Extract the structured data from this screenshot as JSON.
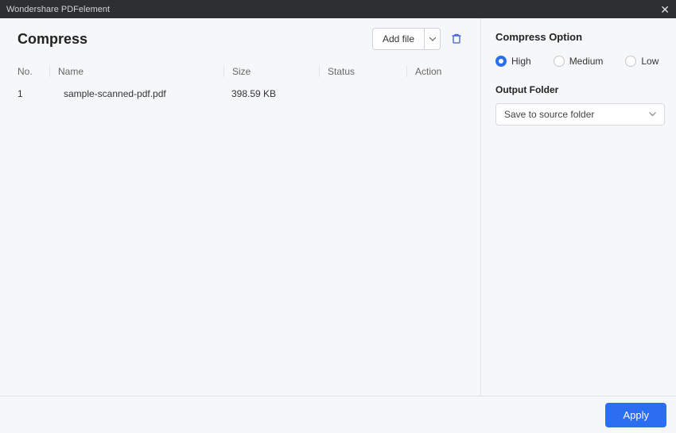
{
  "titlebar": {
    "app_name": "Wondershare PDFelement"
  },
  "main": {
    "title": "Compress",
    "add_file_label": "Add file",
    "columns": {
      "no": "No.",
      "name": "Name",
      "size": "Size",
      "status": "Status",
      "action": "Action"
    },
    "rows": [
      {
        "no": "1",
        "name": "sample-scanned-pdf.pdf",
        "size": "398.59 KB",
        "status": "",
        "action": ""
      }
    ]
  },
  "options": {
    "title": "Compress Option",
    "levels": {
      "high": "High",
      "medium": "Medium",
      "low": "Low"
    },
    "selected_level": "high",
    "output_folder_title": "Output Folder",
    "output_folder_value": "Save to source folder"
  },
  "footer": {
    "apply": "Apply"
  }
}
